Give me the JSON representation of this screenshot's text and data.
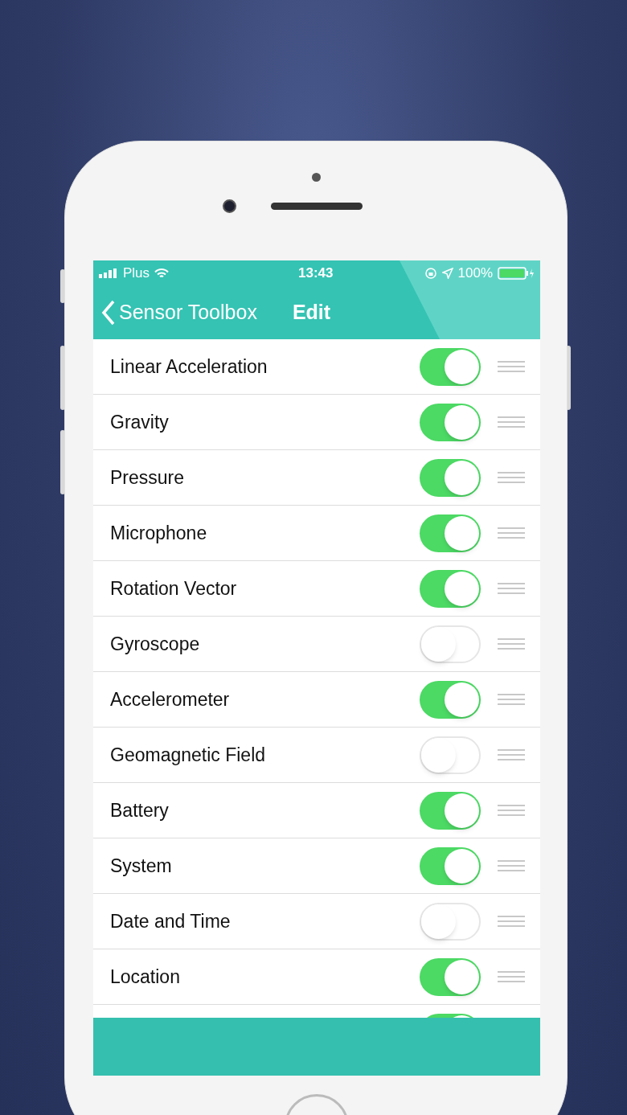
{
  "status_bar": {
    "carrier": "Plus",
    "time": "13:43",
    "battery": "100%"
  },
  "nav_bar": {
    "back_label": "Sensor Toolbox",
    "title": "Edit"
  },
  "sensors": [
    {
      "label": "Linear Acceleration",
      "on": true
    },
    {
      "label": "Gravity",
      "on": true
    },
    {
      "label": "Pressure",
      "on": true
    },
    {
      "label": "Microphone",
      "on": true
    },
    {
      "label": "Rotation Vector",
      "on": true
    },
    {
      "label": "Gyroscope",
      "on": false
    },
    {
      "label": "Accelerometer",
      "on": true
    },
    {
      "label": "Geomagnetic Field",
      "on": false
    },
    {
      "label": "Battery",
      "on": true
    },
    {
      "label": "System",
      "on": true
    },
    {
      "label": "Date and Time",
      "on": false
    },
    {
      "label": "Location",
      "on": true
    },
    {
      "on": true
    }
  ]
}
